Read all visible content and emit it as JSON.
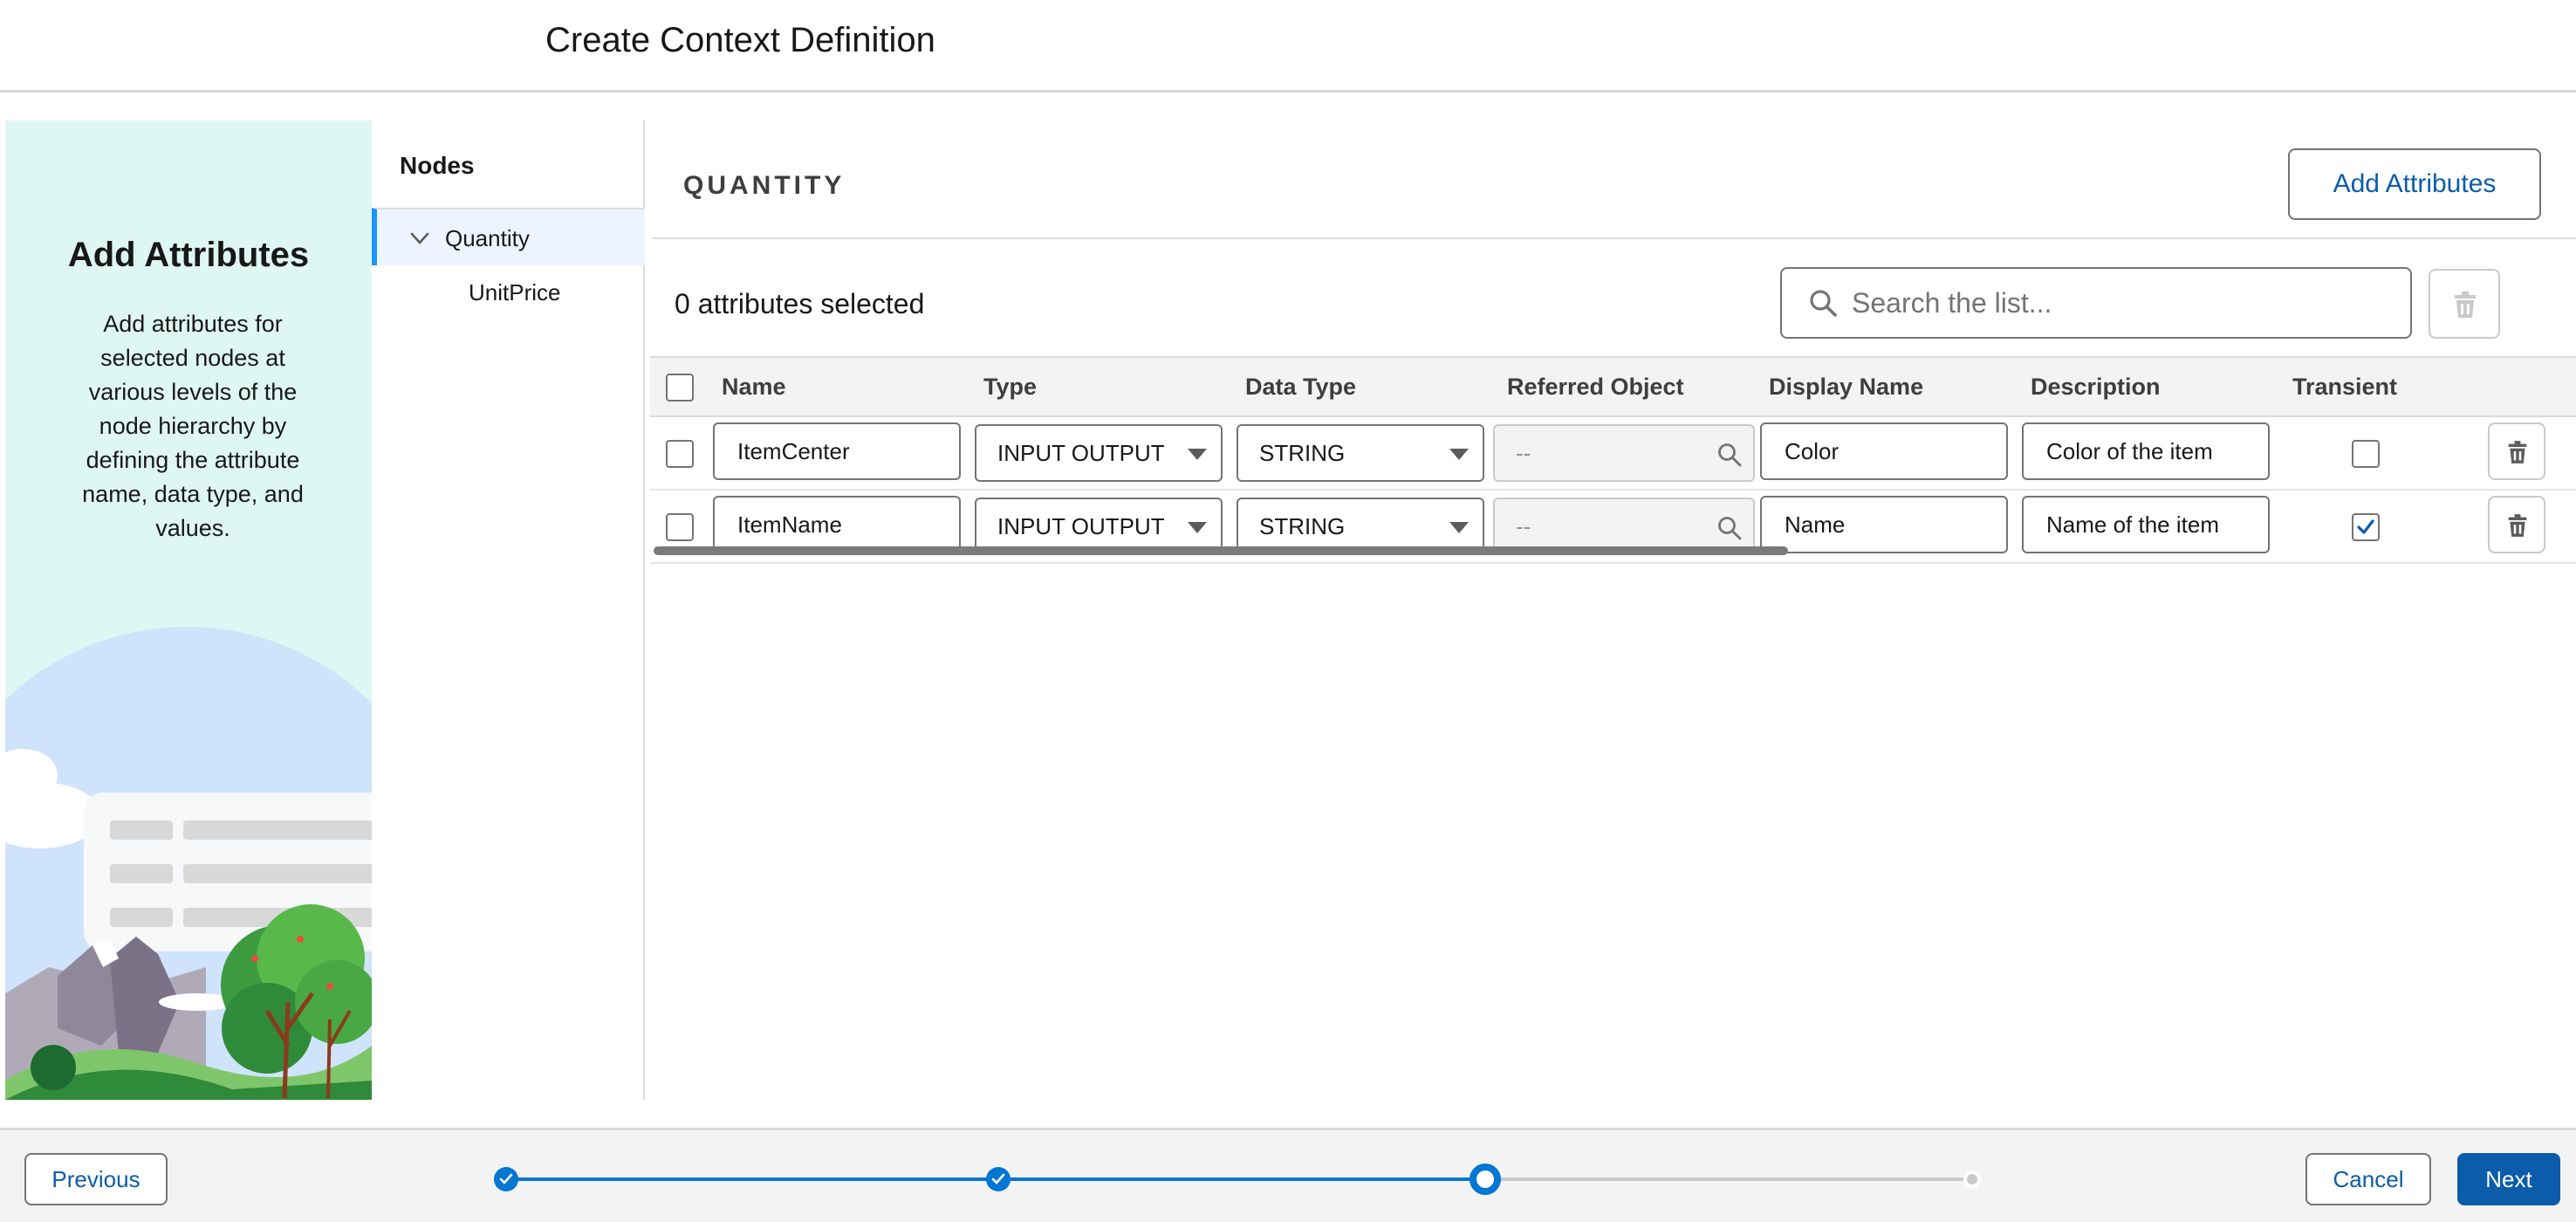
{
  "header": {
    "title": "Create Context Definition"
  },
  "illustration": {
    "title": "Add Attributes",
    "description": "Add attributes for selected nodes at various levels of the node hierarchy by defining the attribute name, data type, and values."
  },
  "nodes": {
    "title": "Nodes",
    "items": [
      {
        "label": "Quantity",
        "expanded": true,
        "selected": true
      },
      {
        "label": "UnitPrice"
      }
    ]
  },
  "main": {
    "section_title": "QUANTITY",
    "add_attributes_label": "Add Attributes",
    "selected_count": "0 attributes selected",
    "search": {
      "placeholder": "Search the list...",
      "value": ""
    }
  },
  "table": {
    "columns": [
      "Name",
      "Type",
      "Data Type",
      "Referred Object",
      "Display Name",
      "Description",
      "Transient"
    ],
    "rows": [
      {
        "name": "ItemCenter",
        "type": "INPUT OUTPUT",
        "data_type": "STRING",
        "referred_object": "--",
        "display_name": "Color",
        "description": "Color of the item",
        "transient": false
      },
      {
        "name": "ItemName",
        "type": "INPUT OUTPUT",
        "data_type": "STRING",
        "referred_object": "--",
        "display_name": "Name",
        "description": "Name of the item",
        "transient": true
      }
    ]
  },
  "footer": {
    "previous_label": "Previous",
    "cancel_label": "Cancel",
    "next_label": "Next",
    "progress": {
      "total_steps": 4,
      "current_step": 3
    }
  },
  "colors": {
    "brand": "#0b5cab",
    "accent": "#0176d3",
    "illustration_bg": "#dff7f3",
    "selected_node_bg": "#eef4ff"
  }
}
